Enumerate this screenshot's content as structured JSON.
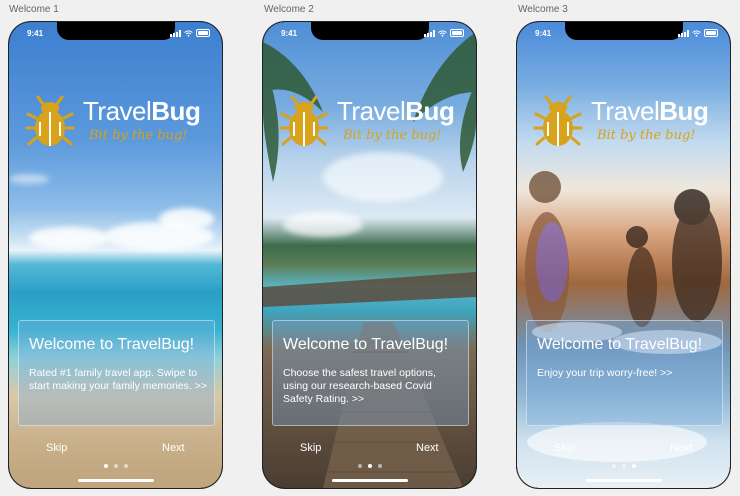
{
  "screens": [
    {
      "frame_label": "Welcome 1",
      "time": "9:41",
      "brand_light": "Travel",
      "brand_bold": "Bug",
      "tagline": "Bit by the bug!",
      "title": "Welcome to TravelBug!",
      "body": "Rated #1 family travel app. Swipe to start making your family memories. >>",
      "skip_label": "Skip",
      "next_label": "Next",
      "active_dot": 0
    },
    {
      "frame_label": "Welcome 2",
      "time": "9:41",
      "brand_light": "Travel",
      "brand_bold": "Bug",
      "tagline": "Bit by the bug!",
      "title": "Welcome to TravelBug!",
      "body": "Choose the safest travel options, using our research-based Covid Safety Rating. >>",
      "skip_label": "Skip",
      "next_label": "Next",
      "active_dot": 1
    },
    {
      "frame_label": "Welcome 3",
      "time": "9:41",
      "brand_light": "Travel",
      "brand_bold": "Bug",
      "tagline": "Bit by the bug!",
      "title": "Welcome to TravelBug!",
      "body": "Enjoy your trip worry-free! >>",
      "skip_label": "Skip",
      "next_label": "Next",
      "active_dot": 2
    }
  ],
  "colors": {
    "logo_gold": "#d8a21a",
    "text_white": "#ffffff"
  },
  "icons": [
    "bug-logo-icon",
    "signal-icon",
    "wifi-icon",
    "battery-icon"
  ]
}
